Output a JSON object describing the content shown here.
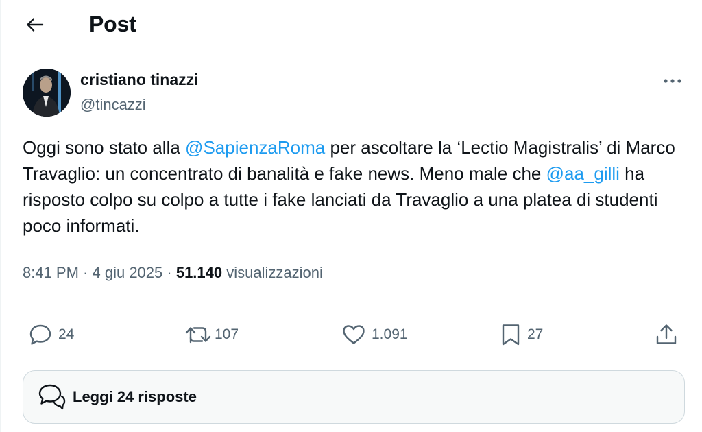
{
  "header": {
    "title": "Post"
  },
  "author": {
    "display_name": "cristiano tinazzi",
    "handle": "@tincazzi"
  },
  "tweet": {
    "seg1": "Oggi sono stato alla ",
    "mention1": "@SapienzaRoma",
    "seg2": " per ascoltare la ‘Lectio Magistralis’ di Marco Travaglio: un concentrato di banalità e fake news. Meno male che ",
    "mention2": "@aa_gilli",
    "seg3": " ha risposto colpo su colpo a tutte i fake lanciati da Travaglio a una platea di studenti poco informati."
  },
  "meta": {
    "time": "8:41 PM",
    "sep1": " · ",
    "date": "4 giu 2025",
    "sep2": " · ",
    "views_count": "51.140",
    "views_label": " visualizzazioni"
  },
  "actions": {
    "replies": "24",
    "reposts": "107",
    "likes": "1.091",
    "bookmarks": "27"
  },
  "replies_box": {
    "label": "Leggi 24 risposte"
  },
  "icons": {
    "back": "arrow-left-icon",
    "more": "more-horizontal-icon",
    "reply": "reply-bubble-icon",
    "repost": "repost-icon",
    "like": "heart-icon",
    "bookmark": "bookmark-icon",
    "share": "share-icon",
    "read_replies": "speech-bubbles-icon"
  },
  "colors": {
    "accent": "#1d9bf0",
    "text": "#0f1419",
    "secondary": "#536471",
    "border": "#eff3f4"
  }
}
